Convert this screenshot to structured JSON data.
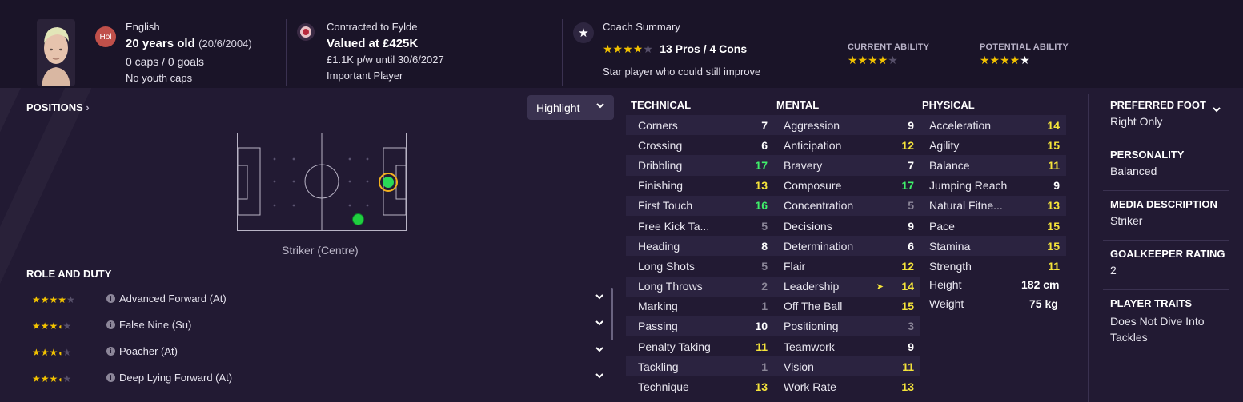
{
  "header": {
    "nation_badge": "Hol",
    "nationality": "English",
    "age": "20 years old",
    "dob": "(20/6/2004)",
    "caps": "0 caps / 0 goals",
    "youth_caps": "No youth caps",
    "contract": "Contracted to Fylde",
    "value": "Valued at £425K",
    "wage": "£1.1K p/w until 30/6/2027",
    "squad_status": "Important Player",
    "coach_title": "Coach Summary",
    "coach_pros_cons": "13 Pros / 4 Cons",
    "coach_rating": 4,
    "coach_summary": "Star player who could still improve",
    "current_ability_label": "CURRENT ABILITY",
    "current_ability_stars": 4,
    "potential_ability_label": "POTENTIAL ABILITY",
    "potential_ability_stars": 4.5
  },
  "positions": {
    "title": "POSITIONS",
    "highlight_label": "Highlight",
    "position_label": "Striker (Centre)"
  },
  "roles": {
    "title": "ROLE AND DUTY",
    "items": [
      {
        "label": "Advanced Forward (At)",
        "stars": 4
      },
      {
        "label": "False Nine (Su)",
        "stars": 3.5
      },
      {
        "label": "Poacher (At)",
        "stars": 3.5
      },
      {
        "label": "Deep Lying Forward (At)",
        "stars": 3.5
      }
    ]
  },
  "attributes": {
    "technical": {
      "title": "TECHNICAL",
      "items": [
        {
          "name": "Corners",
          "value": "7"
        },
        {
          "name": "Crossing",
          "value": "6"
        },
        {
          "name": "Dribbling",
          "value": "17"
        },
        {
          "name": "Finishing",
          "value": "13"
        },
        {
          "name": "First Touch",
          "value": "16"
        },
        {
          "name": "Free Kick Ta...",
          "value": "5"
        },
        {
          "name": "Heading",
          "value": "8"
        },
        {
          "name": "Long Shots",
          "value": "5"
        },
        {
          "name": "Long Throws",
          "value": "2"
        },
        {
          "name": "Marking",
          "value": "1"
        },
        {
          "name": "Passing",
          "value": "10"
        },
        {
          "name": "Penalty Taking",
          "value": "11"
        },
        {
          "name": "Tackling",
          "value": "1"
        },
        {
          "name": "Technique",
          "value": "13"
        }
      ]
    },
    "mental": {
      "title": "MENTAL",
      "items": [
        {
          "name": "Aggression",
          "value": "9"
        },
        {
          "name": "Anticipation",
          "value": "12"
        },
        {
          "name": "Bravery",
          "value": "7"
        },
        {
          "name": "Composure",
          "value": "17"
        },
        {
          "name": "Concentration",
          "value": "5"
        },
        {
          "name": "Decisions",
          "value": "9"
        },
        {
          "name": "Determination",
          "value": "6"
        },
        {
          "name": "Flair",
          "value": "12"
        },
        {
          "name": "Leadership",
          "value": "14"
        },
        {
          "name": "Off The Ball",
          "value": "15"
        },
        {
          "name": "Positioning",
          "value": "3"
        },
        {
          "name": "Teamwork",
          "value": "9"
        },
        {
          "name": "Vision",
          "value": "11"
        },
        {
          "name": "Work Rate",
          "value": "13"
        }
      ]
    },
    "physical": {
      "title": "PHYSICAL",
      "items": [
        {
          "name": "Acceleration",
          "value": "14"
        },
        {
          "name": "Agility",
          "value": "15"
        },
        {
          "name": "Balance",
          "value": "11"
        },
        {
          "name": "Jumping Reach",
          "value": "9"
        },
        {
          "name": "Natural Fitne...",
          "value": "13"
        },
        {
          "name": "Pace",
          "value": "15"
        },
        {
          "name": "Stamina",
          "value": "15"
        },
        {
          "name": "Strength",
          "value": "11"
        }
      ],
      "height_label": "Height",
      "height_value": "182 cm",
      "weight_label": "Weight",
      "weight_value": "75 kg"
    }
  },
  "info": {
    "foot_title": "PREFERRED FOOT",
    "foot_value": "Right Only",
    "personality_title": "PERSONALITY",
    "personality_value": "Balanced",
    "media_title": "MEDIA DESCRIPTION",
    "media_value": "Striker",
    "gk_title": "GOALKEEPER RATING",
    "gk_value": "2",
    "traits_title": "PLAYER TRAITS",
    "traits_value": "Does Not Dive Into Tackles"
  },
  "colors": {
    "star_gold": "#f2c200",
    "value_green": "#3ff06a",
    "value_yellow": "#f5e43a",
    "value_grey": "#8b8698",
    "background": "#221a33"
  }
}
